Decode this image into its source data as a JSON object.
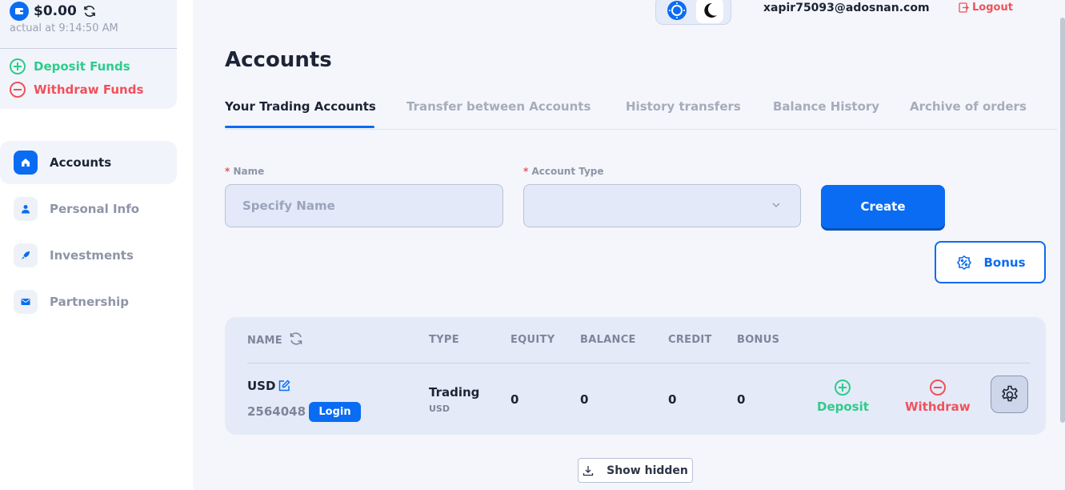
{
  "wallet": {
    "balance": "$0.00",
    "updated": "actual at 9:14:50 AM",
    "deposit_label": "Deposit Funds",
    "withdraw_label": "Withdraw Funds"
  },
  "sidebar": {
    "items": [
      {
        "label": "Accounts",
        "icon": "home-icon",
        "active": true
      },
      {
        "label": "Personal Info",
        "icon": "user-icon",
        "active": false
      },
      {
        "label": "Investments",
        "icon": "rocket-icon",
        "active": false
      },
      {
        "label": "Partnership",
        "icon": "mail-icon",
        "active": false
      }
    ]
  },
  "header": {
    "email": "xapir75093@adosnan.com",
    "logout_label": "Logout"
  },
  "page": {
    "title": "Accounts"
  },
  "tabs": [
    {
      "label": "Your Trading Accounts",
      "active": true
    },
    {
      "label": "Transfer between Accounts",
      "active": false
    },
    {
      "label": "History transfers",
      "active": false
    },
    {
      "label": "Balance History",
      "active": false
    },
    {
      "label": "Archive of orders",
      "active": false
    }
  ],
  "form": {
    "name_label": "Name",
    "name_placeholder": "Specify Name",
    "name_value": "",
    "type_label": "Account Type",
    "type_value": "",
    "required_mark": "*",
    "create_label": "Create",
    "bonus_label": "Bonus"
  },
  "table": {
    "headers": [
      "NAME",
      "TYPE",
      "EQUITY",
      "BALANCE",
      "CREDIT",
      "BONUS"
    ],
    "rows": [
      {
        "currency": "USD",
        "number": "2564048",
        "login_label": "Login",
        "type": "Trading",
        "type_sub": "USD",
        "equity": "0",
        "balance": "0",
        "credit": "0",
        "bonus": "0",
        "deposit_label": "Deposit",
        "withdraw_label": "Withdraw"
      }
    ]
  },
  "show_hidden_label": "Show hidden",
  "colors": {
    "accent": "#0a6cf2",
    "deposit": "#2ecc8a",
    "withdraw": "#f0515a"
  }
}
